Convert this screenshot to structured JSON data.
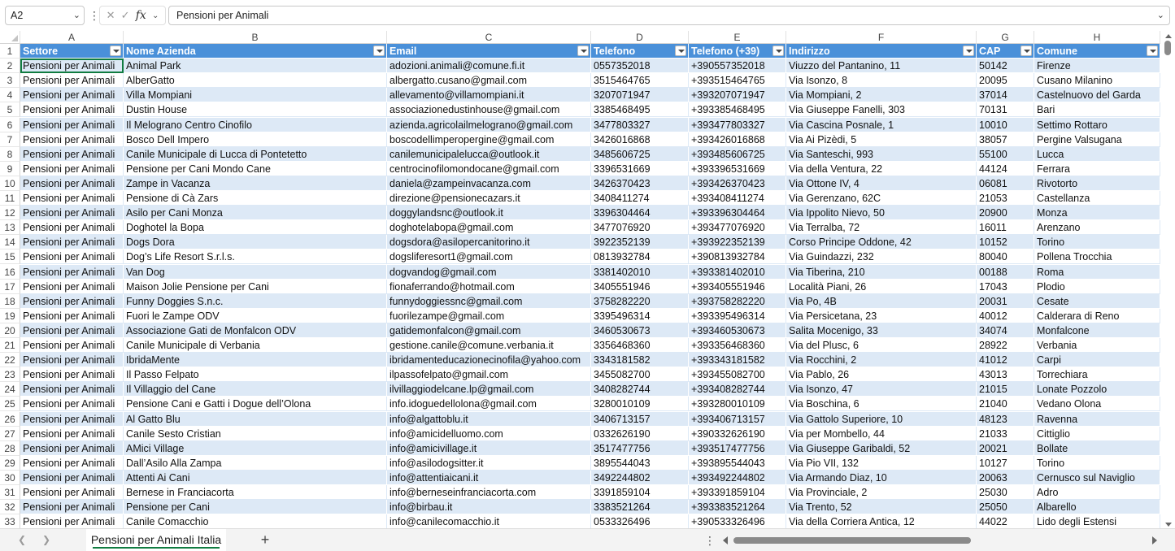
{
  "formula_bar": {
    "name_box": "A2",
    "name_box_menu_icon": "chevron-down-icon",
    "more_icon": "vertical-dots-icon",
    "cancel_icon": "x-icon",
    "enter_icon": "check-icon",
    "fx_label": "fx",
    "formula_value": "Pensioni per Animali",
    "expand_icon": "chevron-down-icon"
  },
  "columns": [
    "A",
    "B",
    "C",
    "D",
    "E",
    "F",
    "G",
    "H"
  ],
  "table": {
    "headers": [
      "Settore",
      "Nome Azienda",
      "Email",
      "Telefono",
      "Telefono (+39)",
      "Indirizzo",
      "CAP",
      "Comune"
    ],
    "header_color": "#4a90d9",
    "band_color": "#dde9f6",
    "rows": [
      [
        "2",
        "Pensioni per Animali",
        "Animal Park",
        "adozioni.animali@comune.fi.it",
        "0557352018",
        "+390557352018",
        "Viuzzo del Pantanino, 11",
        "50142",
        "Firenze"
      ],
      [
        "3",
        "Pensioni per Animali",
        "AlberGatto",
        "albergatto.cusano@gmail.com",
        "3515464765",
        "+393515464765",
        "Via Isonzo, 8",
        "20095",
        "Cusano Milanino"
      ],
      [
        "4",
        "Pensioni per Animali",
        "Villa Mompiani",
        "allevamento@villamompiani.it",
        "3207071947",
        "+393207071947",
        "Via Mompiani, 2",
        "37014",
        "Castelnuovo del Garda"
      ],
      [
        "5",
        "Pensioni per Animali",
        "Dustin House",
        "associazionedustinhouse@gmail.com",
        "3385468495",
        "+393385468495",
        "Via Giuseppe Fanelli, 303",
        "70131",
        "Bari"
      ],
      [
        "6",
        "Pensioni per Animali",
        "Il Melograno Centro Cinofilo",
        "azienda.agricolailmelograno@gmail.com",
        "3477803327",
        "+393477803327",
        "Via Cascina Posnale, 1",
        "10010",
        "Settimo Rottaro"
      ],
      [
        "7",
        "Pensioni per Animali",
        "Bosco Dell Impero",
        "boscodellimperopergine@gmail.com",
        "3426016868",
        "+393426016868",
        "Via Ai Pizèdi, 5",
        "38057",
        "Pergine Valsugana"
      ],
      [
        "8",
        "Pensioni per Animali",
        "Canile Municipale di Lucca di Pontetetto",
        "canilemunicipalelucca@outlook.it",
        "3485606725",
        "+393485606725",
        "Via Santeschi, 993",
        "55100",
        "Lucca"
      ],
      [
        "9",
        "Pensioni per Animali",
        "Pensione per Cani Mondo Cane",
        "centrocinofilomondocane@gmail.com",
        "3396531669",
        "+393396531669",
        "Via della Ventura, 22",
        "44124",
        "Ferrara"
      ],
      [
        "10",
        "Pensioni per Animali",
        "Zampe in Vacanza",
        "daniela@zampeinvacanza.com",
        "3426370423",
        "+393426370423",
        "Via Ottone IV, 4",
        "06081",
        "Rivotorto"
      ],
      [
        "11",
        "Pensioni per Animali",
        "Pensione di Cà Zars",
        "direzione@pensionecazars.it",
        "3408411274",
        "+393408411274",
        "Via Gerenzano, 62C",
        "21053",
        "Castellanza"
      ],
      [
        "12",
        "Pensioni per Animali",
        "Asilo per Cani Monza",
        "doggylandsnc@outlook.it",
        "3396304464",
        "+393396304464",
        "Via Ippolito Nievo, 50",
        "20900",
        "Monza"
      ],
      [
        "13",
        "Pensioni per Animali",
        "Doghotel la Bopa",
        "doghotelabopa@gmail.com",
        "3477076920",
        "+393477076920",
        "Via Terralba, 72",
        "16011",
        "Arenzano"
      ],
      [
        "14",
        "Pensioni per Animali",
        "Dogs Dora",
        "dogsdora@asilopercanitorino.it",
        "3922352139",
        "+393922352139",
        "Corso Principe Oddone, 42",
        "10152",
        "Torino"
      ],
      [
        "15",
        "Pensioni per Animali",
        "Dog’s Life Resort S.r.l.s.",
        "dogsliferesort1@gmail.com",
        "0813932784",
        "+390813932784",
        "Via Guindazzi, 232",
        "80040",
        "Pollena Trocchia"
      ],
      [
        "16",
        "Pensioni per Animali",
        "Van Dog",
        "dogvandog@gmail.com",
        "3381402010",
        "+393381402010",
        "Via Tiberina, 210",
        "00188",
        "Roma"
      ],
      [
        "17",
        "Pensioni per Animali",
        "Maison Jolie Pensione per Cani",
        "fionaferrando@hotmail.com",
        "3405551946",
        "+393405551946",
        "Località Piani, 26",
        "17043",
        "Plodio"
      ],
      [
        "18",
        "Pensioni per Animali",
        "Funny Doggies S.n.c.",
        "funnydoggiessnc@gmail.com",
        "3758282220",
        "+393758282220",
        "Via Po, 4B",
        "20031",
        "Cesate"
      ],
      [
        "19",
        "Pensioni per Animali",
        "Fuori le Zampe ODV",
        "fuorilezampe@gmail.com",
        "3395496314",
        "+393395496314",
        "Via Persicetana, 23",
        "40012",
        "Calderara di Reno"
      ],
      [
        "20",
        "Pensioni per Animali",
        "Associazione Gati de Monfalcon ODV",
        "gatidemonfalcon@gmail.com",
        "3460530673",
        "+393460530673",
        "Salita Mocenigo, 33",
        "34074",
        "Monfalcone"
      ],
      [
        "21",
        "Pensioni per Animali",
        "Canile Municipale di Verbania",
        "gestione.canile@comune.verbania.it",
        "3356468360",
        "+393356468360",
        "Via del Plusc, 6",
        "28922",
        "Verbania"
      ],
      [
        "22",
        "Pensioni per Animali",
        "IbridaMente",
        "ibridamenteducazionecinofila@yahoo.com",
        "3343181582",
        "+393343181582",
        "Via Rocchini, 2",
        "41012",
        "Carpi"
      ],
      [
        "23",
        "Pensioni per Animali",
        "Il Passo Felpato",
        "ilpassofelpato@gmail.com",
        "3455082700",
        "+393455082700",
        "Via Pablo, 26",
        "43013",
        "Torrechiara"
      ],
      [
        "24",
        "Pensioni per Animali",
        "Il Villaggio del Cane",
        "ilvillaggiodelcane.lp@gmail.com",
        "3408282744",
        "+393408282744",
        "Via Isonzo, 47",
        "21015",
        "Lonate Pozzolo"
      ],
      [
        "25",
        "Pensioni per Animali",
        "Pensione Cani e Gatti i Dogue dell’Olona",
        "info.idoguedellolona@gmail.com",
        "3280010109",
        "+393280010109",
        "Via Boschina, 6",
        "21040",
        "Vedano Olona"
      ],
      [
        "26",
        "Pensioni per Animali",
        "Al Gatto Blu",
        "info@algattoblu.it",
        "3406713157",
        "+393406713157",
        "Via Gattolo Superiore, 10",
        "48123",
        "Ravenna"
      ],
      [
        "27",
        "Pensioni per Animali",
        "Canile Sesto Cristian",
        "info@amicidelluomo.com",
        "0332626190",
        "+390332626190",
        "Via per Mombello, 44",
        "21033",
        "Cittiglio"
      ],
      [
        "28",
        "Pensioni per Animali",
        "AMici Village",
        "info@amicivillage.it",
        "3517477756",
        "+393517477756",
        "Via Giuseppe Garibaldi, 52",
        "20021",
        "Bollate"
      ],
      [
        "29",
        "Pensioni per Animali",
        "Dall’Asilo Alla Zampa",
        "info@asilodogsitter.it",
        "3895544043",
        "+393895544043",
        "Via Pio VII, 132",
        "10127",
        "Torino"
      ],
      [
        "30",
        "Pensioni per Animali",
        "Attenti Ai Cani",
        "info@attentiaicani.it",
        "3492244802",
        "+393492244802",
        "Via Armando Diaz, 10",
        "20063",
        "Cernusco sul Naviglio"
      ],
      [
        "31",
        "Pensioni per Animali",
        "Bernese in Franciacorta",
        "info@berneseinfranciacorta.com",
        "3391859104",
        "+393391859104",
        "Via Provinciale, 2",
        "25030",
        "Adro"
      ],
      [
        "32",
        "Pensioni per Animali",
        "Pensione per Cani",
        "info@birbau.it",
        "3383521264",
        "+393383521264",
        "Via Trento, 52",
        "25050",
        "Albarello"
      ],
      [
        "33",
        "Pensioni per Animali",
        "Canile Comacchio",
        "info@canilecomacchio.it",
        "0533326496",
        "+390533326496",
        "Via della Corriera Antica, 12",
        "44022",
        "Lido degli Estensi"
      ]
    ]
  },
  "sheet_bar": {
    "prev_icon": "chevron-left-icon",
    "next_icon": "chevron-right-icon",
    "active_sheet": "Pensioni per Animali Italia",
    "add_sheet_label": "+",
    "accent_color": "#107c41"
  }
}
